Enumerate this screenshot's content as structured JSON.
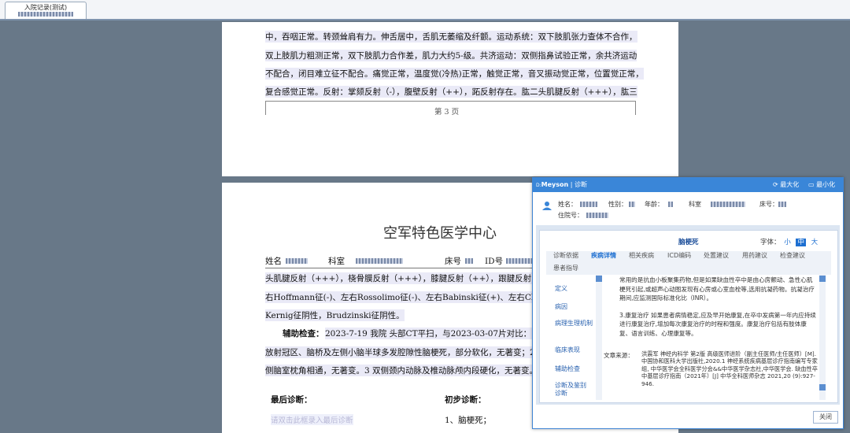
{
  "tab": {
    "title": "入院记录(测试)",
    "subtitle": ""
  },
  "page3": {
    "lines": [
      "中，吞咽正常。转颈耸肩有力。伸舌居中，舌肌无萎缩及纤颤。运动系统：双下肢肌张力查体不合作，",
      "双上肢肌力粗测正常，双下肢肌力合作差，肌力大约5-级。共济运动：双侧指鼻试验正常，余共济运动",
      "不配合，闭目难立征不配合。痛觉正常，温度觉(冷热)正常，触觉正常，音叉振动觉正常，位置觉正常，",
      "复合感觉正常。反射：掌颏反射（-），腹壁反射（++），跖反射存在。肱二头肌腱反射（+++），肱三"
    ],
    "page_number": "第 3 页"
  },
  "page4": {
    "hospital": "空军特色医学中心",
    "field_name": "姓名",
    "field_dept": "科室",
    "field_bed": "床号",
    "field_id": "ID号",
    "lines": [
      "头肌腱反射（+++），桡骨膜反射（+++），膝腱反射（++），跟腱反射（++",
      "右Hoffmann征(-)、左右Rossolimo征(-)、左右Babinski征(+)、左右Chaddo",
      "Kernig征阴性，Brudzinski征阴性。"
    ],
    "aux_label": "辅助检查：",
    "aux_lines": [
      "2023-7-19 我院 头部CT平扫，与2023-03-07片对比：1 双",
      "放射冠区、脑桥及左侧小脑半球多发腔隙性脑梗死，部分软化，无著变；2",
      "侧脑室枕角相通，无著变。3 双侧颈内动脉及椎动脉颅内段硬化，无著变。"
    ],
    "final_diag_label": "最后诊断：",
    "final_diag_placeholder": "请双击此框录入最后诊断",
    "initial_diag_label": "初步诊断：",
    "initial_diag_item": "1、脑梗死；"
  },
  "panel": {
    "brand": "Meyson",
    "subtitle": "诊断",
    "maximize": "最大化",
    "minimize": "最小化",
    "patient": {
      "name_label": "姓名：",
      "gender_label": "性别：",
      "age_label": "年龄：",
      "dept_label": "科室",
      "bed_label": "床号：",
      "admit_label": "住院号："
    },
    "disease": "脑梗死",
    "font_label": "字体：",
    "font_small": "小",
    "font_medium": "中",
    "font_large": "大",
    "tabs": [
      "诊断依据",
      "疾病详情",
      "相关疾病",
      "ICD编码",
      "处置建议",
      "用药建议",
      "检查建议",
      "患者指导"
    ],
    "active_tab": "疾病详情",
    "nav": [
      "定义",
      "病因",
      "病理生理机制",
      "临床表现",
      "辅助检查",
      "诊断及鉴别诊断"
    ],
    "content": {
      "p1": "常用的是抗血小板聚集药物,但是如果缺血性卒中是由心房颤动、急性心肌梗死引起,或超声心动图发现有心房或心室血栓等,选用抗凝药物。抗凝治疗期间,应监测国际标准化比（INR）。",
      "p2": "3.康复治疗 如果患者病情稳定,应及早开始康复,在卒中发病第一年内应持续进行康复治疗,增加每次康复治疗的时程和强度。康复治疗包括有肢体康复、语言训练、心理康复等。",
      "source_label": "文章来源：",
      "source_text": "洪震军 神经内科学 第2版 高级医师进阶（副主任医师/主任医师）[M]. 中国协和医科大学出版社,2020.1 神经系统疾病基层诊疗指南编写专家组, 中华医学会全科医学分会&&中华医学杂志社,中华医学会. 缺血性卒中基层诊疗指南（2021年）[J] 中华全科医师杂志 2021,20 (9):927-946."
    },
    "close": "关闭"
  },
  "colors": {
    "titlebar": "#3a86d8",
    "background": "#687888",
    "accent": "#1d6fd1"
  }
}
